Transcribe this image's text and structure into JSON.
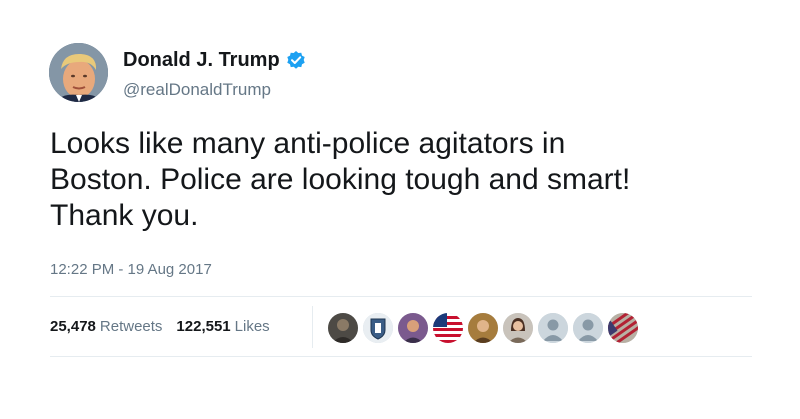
{
  "author": {
    "display_name": "Donald J. Trump",
    "handle": "@realDonaldTrump",
    "verified_icon": "verified-badge-icon",
    "avatar_icon": "profile-photo"
  },
  "tweet": {
    "text": "Looks like many anti-police agitators in\nBoston. Police are looking tough and smart!\nThank you.",
    "timestamp": "12:22 PM - 19 Aug 2017"
  },
  "stats": {
    "retweets_count": "25,478",
    "retweets_label": "Retweets",
    "likes_count": "122,551",
    "likes_label": "Likes"
  },
  "likers": [
    "user-avatar",
    "badge-avatar",
    "user-avatar",
    "flag-avatar",
    "user-avatar",
    "user-avatar",
    "default-avatar",
    "default-avatar",
    "flag-avatar"
  ],
  "colors": {
    "verified": "#1da1f2",
    "secondary_text": "#657786",
    "primary_text": "#14171a",
    "divider": "#e6ecf0"
  }
}
